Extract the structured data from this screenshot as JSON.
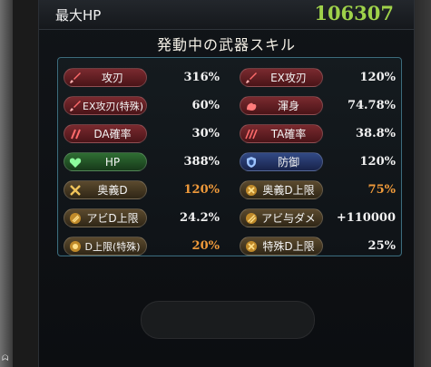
{
  "header": {
    "hp_label": "最大HP",
    "hp_value": "106307"
  },
  "section_title": "発動中の武器スキル",
  "rows": [
    {
      "left": {
        "label": "攻刃",
        "value": "316%",
        "color": "red",
        "icon": "sword-icon"
      },
      "right": {
        "label": "EX攻刃",
        "value": "120%",
        "color": "red",
        "icon": "sword-icon"
      }
    },
    {
      "left": {
        "label": "EX攻刃(特殊)",
        "value": "60%",
        "color": "red",
        "icon": "sword-icon"
      },
      "right": {
        "label": "渾身",
        "value": "74.78%",
        "color": "red",
        "icon": "muscle-icon"
      }
    },
    {
      "left": {
        "label": "DA確率",
        "value": "30%",
        "color": "red",
        "icon": "double-attack-icon"
      },
      "right": {
        "label": "TA確率",
        "value": "38.8%",
        "color": "red",
        "icon": "triple-attack-icon"
      }
    },
    {
      "left": {
        "label": "HP",
        "value": "388%",
        "color": "green",
        "icon": "heart-icon"
      },
      "right": {
        "label": "防御",
        "value": "120%",
        "color": "blue",
        "icon": "shield-icon"
      }
    },
    {
      "left": {
        "label": "奥義D",
        "value": "120%",
        "color": "brown",
        "icon": "ougi-damage-icon",
        "value_color": "orange"
      },
      "right": {
        "label": "奥義D上限",
        "value": "75%",
        "color": "brown",
        "icon": "ougi-cap-icon",
        "value_color": "orange"
      }
    },
    {
      "left": {
        "label": "アビD上限",
        "value": "24.2%",
        "color": "brown",
        "icon": "ability-cap-icon"
      },
      "right": {
        "label": "アビ与ダメ",
        "value": "+110000",
        "color": "brown",
        "icon": "ability-damage-icon"
      }
    },
    {
      "left": {
        "label": "D上限(特殊)",
        "value": "20%",
        "color": "brown",
        "icon": "damage-cap-icon",
        "value_color": "orange"
      },
      "right": {
        "label": "特殊D上限",
        "value": "25%",
        "color": "brown",
        "icon": "special-cap-icon"
      }
    }
  ],
  "colors": {
    "hp_green": "#9fd24a",
    "orange": "#f09a3a",
    "panel_border": "#3d6c7c"
  }
}
